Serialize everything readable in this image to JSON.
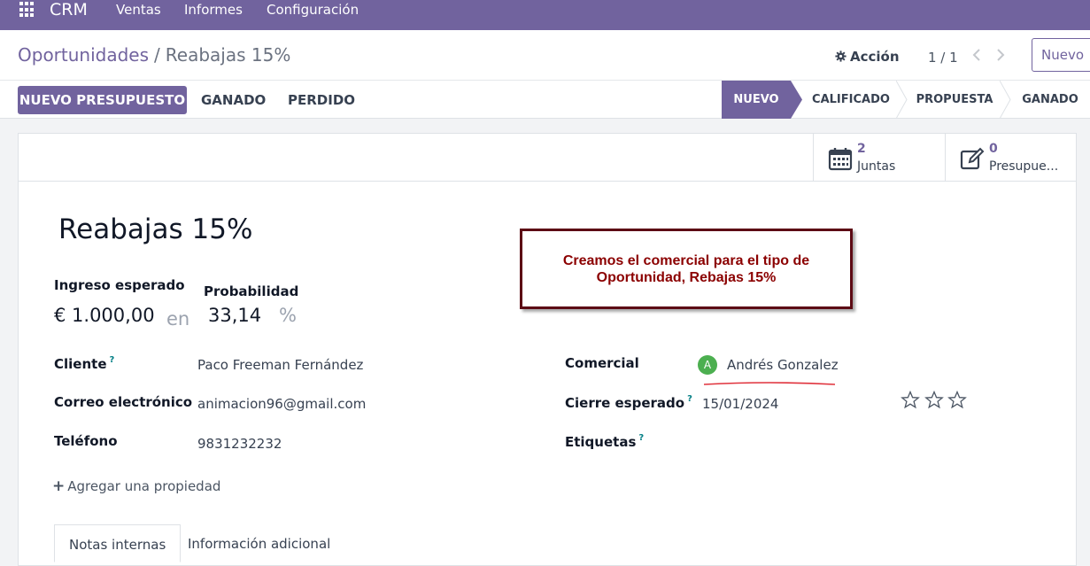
{
  "topbar": {
    "app_name": "CRM",
    "menu": [
      "Ventas",
      "Informes",
      "Configuración"
    ]
  },
  "breadcrumb": {
    "parent": "Oportunidades",
    "separator": "/",
    "current": "Reabajas 15%"
  },
  "toolbar": {
    "action_label": "Acción",
    "pager": "1 / 1",
    "new_label": "Nuevo"
  },
  "statusbar": {
    "primary_button": "NUEVO PRESUPUESTO",
    "buttons": [
      "GANADO",
      "PERDIDO"
    ],
    "stages": [
      "NUEVO",
      "CALIFICADO",
      "PROPUESTA",
      "GANADO"
    ],
    "active_stage": "NUEVO"
  },
  "smart_buttons": [
    {
      "icon": "calendar-icon",
      "count": "2",
      "label": "Juntas"
    },
    {
      "icon": "edit-icon",
      "count": "0",
      "label": "Presupue..."
    }
  ],
  "form": {
    "title": "Reabajas 15%",
    "expected_revenue_label": "Ingreso esperado",
    "expected_revenue": "€ 1.000,00",
    "in_word": "en",
    "probability_label": "Probabilidad",
    "probability": "33,14",
    "percent_sign": "%",
    "customer_label": "Cliente",
    "customer": "Paco Freeman Fernández",
    "email_label": "Correo electrónico",
    "email": "animacion96@gmail.com",
    "phone_label": "Teléfono",
    "phone": "9831232232",
    "salesperson_label": "Comercial",
    "salesperson_initial": "A",
    "salesperson": "Andrés Gonzalez",
    "deadline_label": "Cierre esperado",
    "deadline": "15/01/2024",
    "tags_label": "Etiquetas",
    "priority_stars": 0,
    "help_mark": "?",
    "add_property": "Agregar una propiedad"
  },
  "tabs": [
    "Notas internas",
    "Información adicional"
  ],
  "callout": {
    "line1": "Creamos el comercial para el tipo de",
    "line2": "Oportunidad, Rebajas 15%"
  },
  "colors": {
    "brand": "#71639e",
    "callout_border": "#5c0a14",
    "callout_text": "#8b0000",
    "avatar": "#4caf50"
  }
}
